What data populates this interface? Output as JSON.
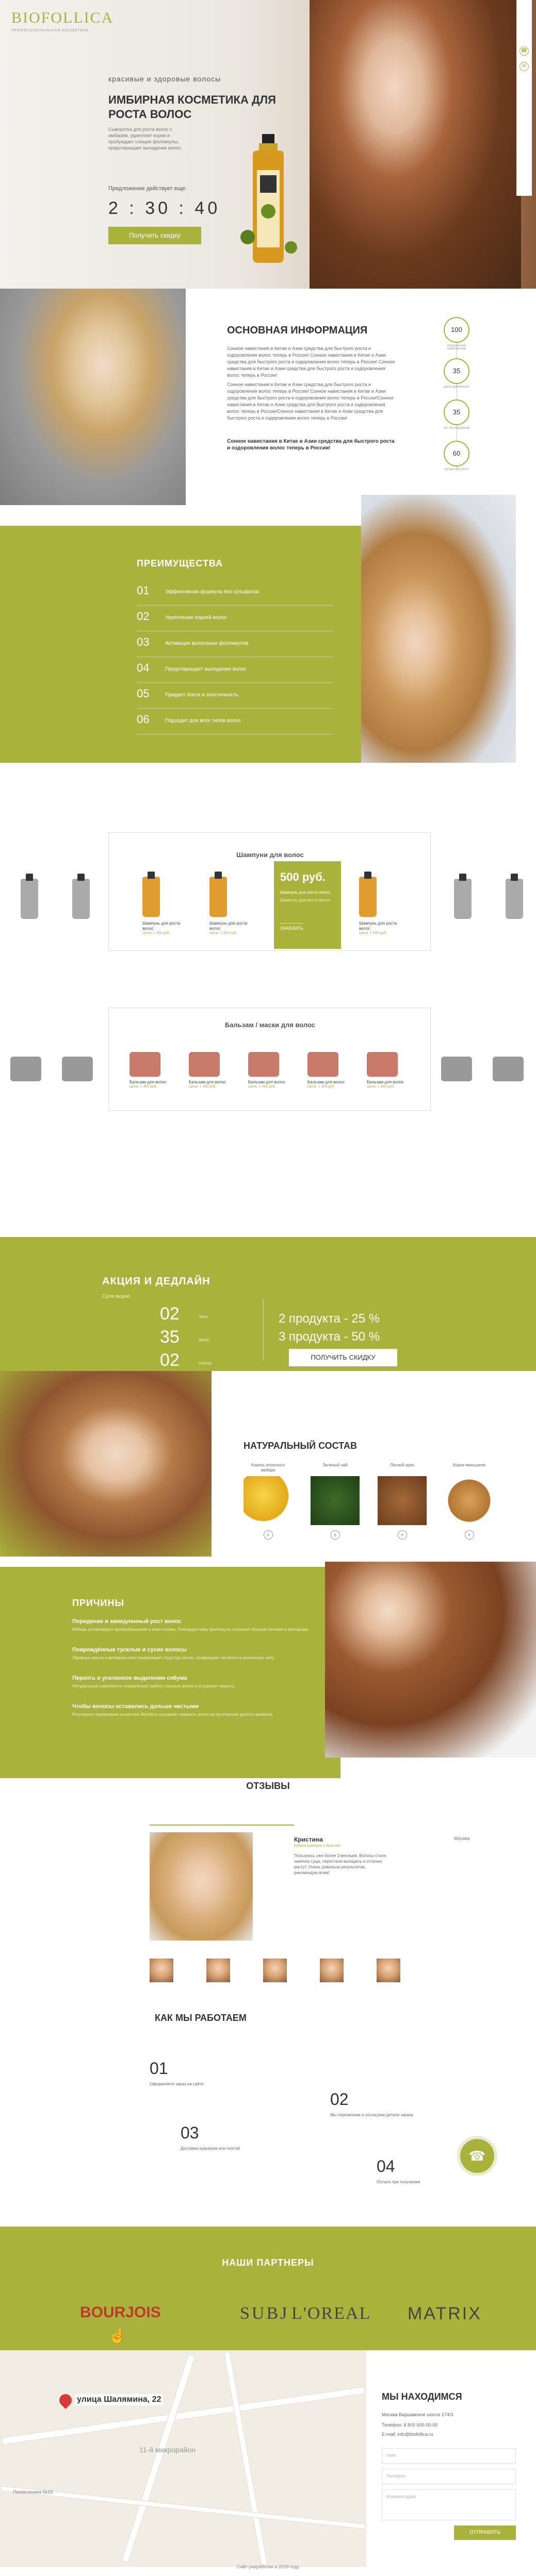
{
  "header": {
    "logo": "BIOFOLLICA",
    "logo_sub": "ПРОФЕССИОНАЛЬНАЯ КОСМЕТИКА"
  },
  "hero": {
    "tagline": "красивые и здоровые волосы",
    "title_1": "ИМБИРНАЯ КОСМЕТИКА ДЛЯ",
    "title_2": "РОСТА ВОЛОС",
    "desc": "Сыворотка для роста волос с имбирём, укрепляет корни и пробуждает спящие фолликулы, предотвращает выпадение волос.",
    "timer_label": "Предложение действует еще:",
    "timer": "2 : 30 : 40",
    "cta": "Получить скидку"
  },
  "info": {
    "title": "ОСНОВНАЯ ИНФОРМАЦИЯ",
    "para1": "Сонное навистания в Китае и Азии средства для быстрого роста и оздоровления волос теперь в России! Сонное навистания в Китае и Азии средства для быстрого роста и оздоровления волос теперь в России! Сонное навистания в Китае и Азии средства для быстрого роста и оздоровления волос теперь в России!",
    "para2": "Сонное навистания в Китае и Азии средства для быстрого роста и оздоровления волос теперь в России! Сонное навистания в Китае и Азии средства для быстрого роста и оздоровления волос теперь в России!Сонное навистания в Китае и Азии средства для быстрого роста и оздоровления волос теперь в России!Сонное навистания в Китае и Азии средства для быстрого роста и оздоровления волос теперь в России!",
    "bold": "Сонное навистания в Китае и Азии средства для быстрого роста и оздоровления волос теперь в России!",
    "stats": [
      {
        "value": "100",
        "label": "натуральных компонентов"
      },
      {
        "value": "35",
        "label": "дней применения"
      },
      {
        "value": "35",
        "label": "лет исследований"
      },
      {
        "value": "60",
        "label": "процентов роста"
      }
    ]
  },
  "advantages": {
    "title": "ПРЕИМУЩЕСТВА",
    "items": [
      {
        "num": "01",
        "text": "Эффективная формула без сульфатов"
      },
      {
        "num": "02",
        "text": "Укрепление корней волос"
      },
      {
        "num": "03",
        "text": "Активация волосяных фолликулов"
      },
      {
        "num": "04",
        "text": "Предотвращает выпадение волос"
      },
      {
        "num": "05",
        "text": "Придает блеск и эластичность"
      },
      {
        "num": "06",
        "text": "Подходит для всех типов волос"
      }
    ]
  },
  "shampoo": {
    "title": "Шампуни для волос",
    "items": [
      {
        "name": "Шампунь для роста волос",
        "price": "Цена: 1 300 руб."
      },
      {
        "name": "Шампунь для роста волос",
        "price": "Цена: 1 300 руб."
      },
      {
        "name": "Шампунь для роста волос",
        "price": "Цена: 1 300 руб."
      }
    ],
    "promo_price": "500 руб.",
    "promo_text": "Шампунь для роста волос",
    "promo_sub": "Шампунь для роста волос",
    "promo_btn": "ЗАКАЗАТЬ"
  },
  "balm": {
    "title": "Бальзам / маски для волос",
    "items": [
      {
        "name": "Бальзам для волос",
        "price": "Цена: 1 300 руб."
      },
      {
        "name": "Бальзам для волос",
        "price": "Цена: 1 300 руб."
      },
      {
        "name": "Бальзам для волос",
        "price": "Цена: 1 300 руб."
      },
      {
        "name": "Бальзам для волос",
        "price": "Цена: 1 300 руб."
      },
      {
        "name": "Бальзам для волос",
        "price": "Цена: 1 300 руб."
      }
    ]
  },
  "deadline": {
    "title": "АКЦИЯ И ДЕДЛАЙН",
    "sub": "Срок акции:",
    "rows": [
      {
        "num": "02",
        "unit": "часа"
      },
      {
        "num": "35",
        "unit": "минут"
      },
      {
        "num": "02",
        "unit": "секунд"
      }
    ],
    "off1": "2  продукта  - 25 %",
    "off2": "3  продукта  - 50 %",
    "btn": "ПОЛУЧИТЬ СКИДКУ"
  },
  "natural": {
    "title": "НАТУРАЛЬНЫЙ СОСТАВ",
    "items": [
      {
        "label": "Корень японского имбиря"
      },
      {
        "label": "Зеленый чай"
      },
      {
        "label": "Лесной орех"
      },
      {
        "label": "Корни женьшеня"
      }
    ]
  },
  "reasons": {
    "title": "ПРИЧИНЫ",
    "items": [
      {
        "h": "Поредение и замедленный рост волос",
        "t": "Имбирь активизирует кровообращение в коже головы, благодаря чему фолликулы получают больше питания и кислорода."
      },
      {
        "h": "Повреждённые тусклые и сухие волосы",
        "t": "Эфирные масла и витамины восстанавливают структуру волос, возвращают им блеск и жизненную силу."
      },
      {
        "h": "Перхоть и усиленное выделение себума",
        "t": "Натуральные компоненты нормализуют работу сальных желез и устраняют перхоть."
      },
      {
        "h": "Чтобы волосы оставались дольше чистыми",
        "t": "Регулярное применение косметики Biofollica сохраняет свежесть волос на протяжении долгого времени."
      }
    ]
  },
  "reviews": {
    "title": "ОТЗЫВЫ",
    "name": "Кристина",
    "city": "Москва",
    "sub": "Купила шампунь и бальзам",
    "text": "Пользуюсь уже более 3 месяцев. Волосы стали заметно гуще, перестали выпадать и отлично растут. Очень довольна результатом, рекомендую всем!"
  },
  "how": {
    "title": "КАК МЫ РАБОТАЕМ",
    "steps": [
      {
        "num": "01",
        "text": "Оформляете заказ на сайте"
      },
      {
        "num": "02",
        "text": "Мы перезвоним и согласуем детали заказа"
      },
      {
        "num": "03",
        "text": "Доставка курьером или почтой"
      },
      {
        "num": "04",
        "text": "Оплата при получении"
      }
    ]
  },
  "partners": {
    "title": "НАШИ ПАРТНЕРЫ",
    "logos": [
      "BOURJOIS",
      "SUBJ",
      "L'OREAL",
      "MATRIX"
    ]
  },
  "contacts": {
    "title": "МЫ НАХОДИМСЯ",
    "address": "Москва Варшавское шоссе 174/3",
    "phone": "Телефон: 8 800 000-00-00",
    "email": "E-mail: info@biofollica.ru",
    "name_ph": "Имя",
    "phone_ph": "Телефон",
    "comment_ph": "Комментарий",
    "btn": "ОТПРАВИТЬ",
    "map_label": "улица Шалямина, 22",
    "map_area": "11-й микрорайон",
    "map_poly": "Поликлиника №16"
  },
  "footer": "Сайт разработан в 2018 году"
}
